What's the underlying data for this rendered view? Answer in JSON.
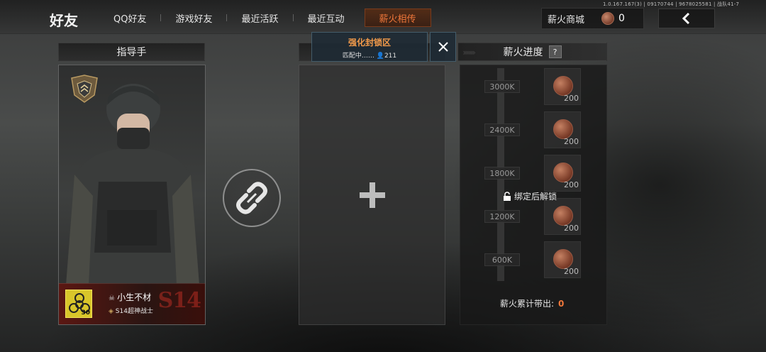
{
  "version_text": "1.0.167.167(3) | 09170744 | 9678025581 | 战队41-7",
  "page_title": "好友",
  "tabs": [
    {
      "label": "QQ好友"
    },
    {
      "label": "游戏好友"
    },
    {
      "label": "最近活跃"
    },
    {
      "label": "最近互动"
    },
    {
      "label": "薪火相传",
      "active": true
    }
  ],
  "shop": {
    "label": "薪火商城",
    "count": "0",
    "icon": "coin-icon"
  },
  "back_icon": "chevron-left-icon",
  "mentor": {
    "header": "指导手",
    "player_name": "小生不材",
    "player_title": "S14超神战士",
    "level": "30",
    "season_mark": "S14"
  },
  "link_icon": "broken-link-icon",
  "match_popup": {
    "mode": "强化封锁区",
    "status": "匹配中…… ",
    "count": "211"
  },
  "add_icon": "plus-icon",
  "progress": {
    "header": "薪火进度",
    "help": "?",
    "tiers": [
      {
        "label": "3000K",
        "reward": "200"
      },
      {
        "label": "2400K",
        "reward": "200"
      },
      {
        "label": "1800K",
        "reward": "200"
      },
      {
        "label": "1200K",
        "reward": "200"
      },
      {
        "label": "600K",
        "reward": "200"
      }
    ],
    "lock_note": "绑定后解锁",
    "total_label": "薪火累计带出:",
    "total_value": "0"
  },
  "colors": {
    "accent": "#f0773a",
    "popup_mode": "#f29a4a"
  }
}
